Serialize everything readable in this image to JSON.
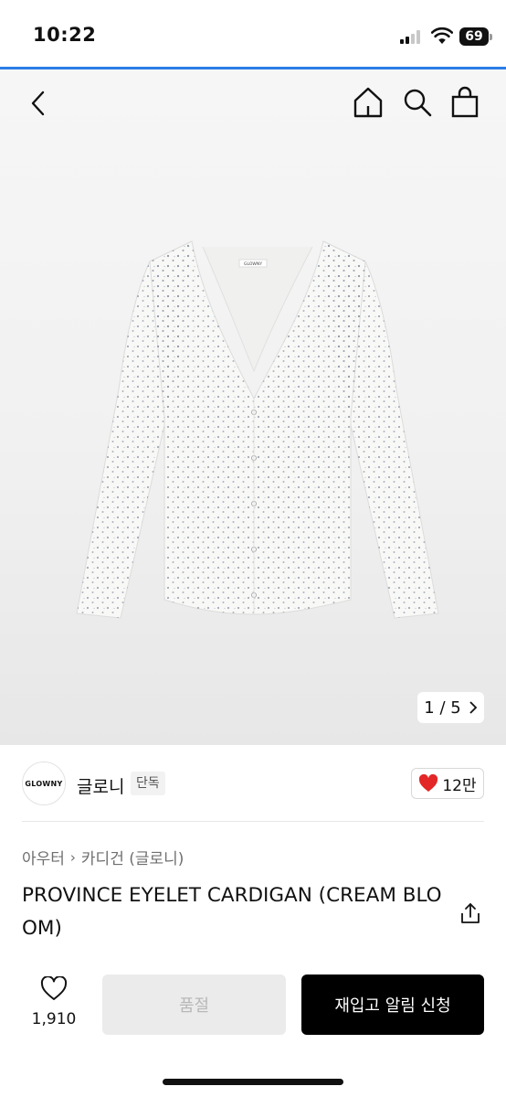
{
  "status_bar": {
    "time": "10:22",
    "battery": "69"
  },
  "nav": {
    "icons": [
      "back-arrow-icon",
      "home-icon",
      "search-icon",
      "shopping-bag-icon"
    ]
  },
  "gallery": {
    "pager": "1 / 5",
    "label_on_garment": "GLOWNY"
  },
  "brand": {
    "logo_text": "GLOWNY",
    "name": "글로니",
    "badge": "단독",
    "likes": "12만"
  },
  "product": {
    "breadcrumb": [
      "아우터",
      "카디건 (글로니)"
    ],
    "title": "PROVINCE EYELET CARDIGAN (CREAM BLOOM)"
  },
  "action_bar": {
    "like_count": "1,910",
    "soldout_label": "품절",
    "restock_label": "재입고 알림 신청"
  },
  "colors": {
    "accent_line": "#2b7ee6",
    "heart": "#e32626",
    "primary_button": "#000000",
    "disabled_button": "#ebebeb"
  }
}
